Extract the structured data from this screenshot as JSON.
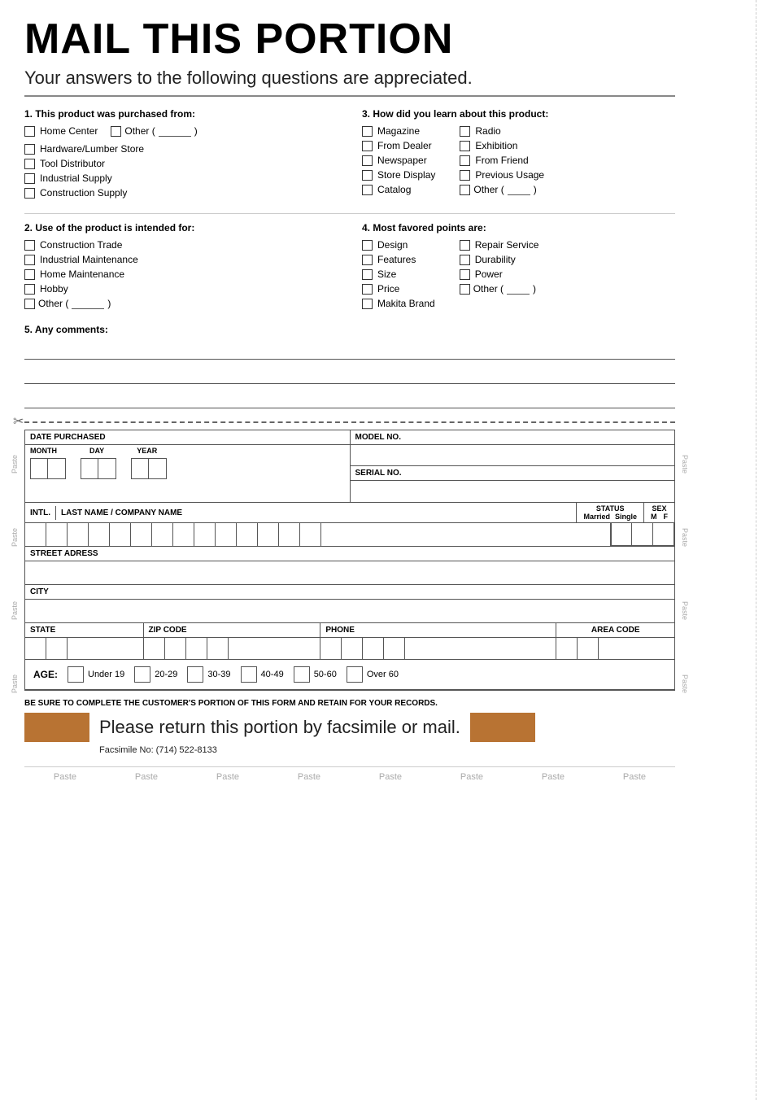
{
  "title": "MAIL THIS PORTION",
  "subtitle": "Your answers to the following questions are appreciated.",
  "questions": [
    {
      "id": "q1",
      "label": "1. This product was purchased from:",
      "items": [
        {
          "text": "Home Center"
        },
        {
          "text": "Hardware/Lumber Store"
        },
        {
          "text": "Tool Distributor"
        },
        {
          "text": "Industrial Supply"
        },
        {
          "text": "Construction Supply"
        }
      ],
      "has_other": true,
      "other_label": "Other ("
    },
    {
      "id": "q2",
      "label": "2. Use of the product is intended for:",
      "items": [
        {
          "text": "Construction Trade"
        },
        {
          "text": "Industrial Maintenance"
        },
        {
          "text": "Home Maintenance"
        },
        {
          "text": "Hobby"
        }
      ],
      "has_other": true,
      "other_label": "Other ("
    },
    {
      "id": "q3",
      "label": "3. How did you learn about this product:",
      "items": [
        {
          "text": "Magazine",
          "col2": "Radio"
        },
        {
          "text": "From Dealer",
          "col2": "Exhibition"
        },
        {
          "text": "Newspaper",
          "col2": "From Friend"
        },
        {
          "text": "Store Display",
          "col2": "Previous Usage"
        },
        {
          "text": "Catalog",
          "col2": "Other (",
          "col2_other": true
        }
      ]
    },
    {
      "id": "q4",
      "label": "4. Most favored points are:",
      "items": [
        {
          "text": "Design",
          "col2": "Repair Service"
        },
        {
          "text": "Features",
          "col2": "Durability"
        },
        {
          "text": "Size",
          "col2": "Power"
        },
        {
          "text": "Price",
          "col2": "Other (",
          "col2_other": true
        },
        {
          "text": "Makita Brand"
        }
      ]
    }
  ],
  "q5_label": "5. Any comments:",
  "form": {
    "date_purchased_label": "DATE PURCHASED",
    "month_label": "MONTH",
    "day_label": "DAY",
    "year_label": "YEAR",
    "model_no_label": "MODEL NO.",
    "serial_no_label": "SERIAL NO.",
    "intl_label": "INTL.",
    "name_label": "LAST NAME / COMPANY NAME",
    "status_label": "STATUS",
    "married_label": "Married",
    "single_label": "Single",
    "sex_label": "SEX",
    "m_label": "M",
    "f_label": "F",
    "street_label": "STREET ADRESS",
    "city_label": "CITY",
    "state_label": "STATE",
    "zip_label": "ZIP CODE",
    "phone_label": "PHONE",
    "area_code_label": "AREA CODE",
    "age_label": "AGE:",
    "age_ranges": [
      "Under 19",
      "20-29",
      "30-39",
      "40-49",
      "50-60",
      "Over 60"
    ]
  },
  "bottom_note": "BE SURE TO COMPLETE THE CUSTOMER'S PORTION OF THIS FORM AND RETAIN FOR YOUR RECORDS.",
  "return_text": "Please return this portion by facsimile or mail.",
  "fax_text": "Facsimile No: (714) 522-8133",
  "paste_labels": [
    "Paste",
    "Paste",
    "Paste",
    "Paste",
    "Paste",
    "Paste",
    "Paste",
    "Paste"
  ],
  "paste_side_label": "Paste",
  "cut_scissors": "✂"
}
